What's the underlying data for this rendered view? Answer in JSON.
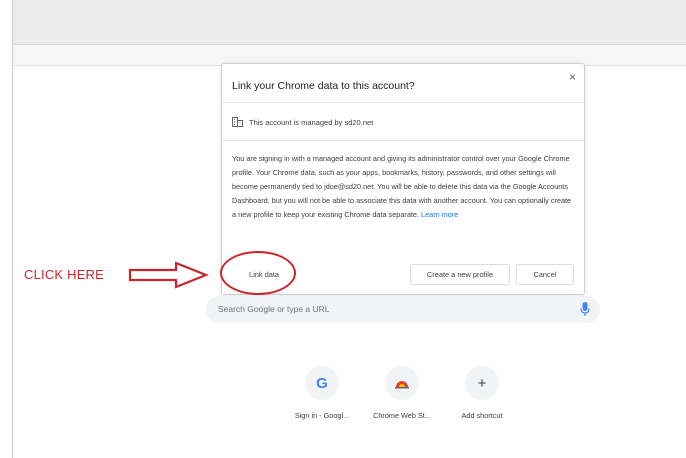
{
  "dialog": {
    "title": "Link your Chrome data to this account?",
    "managed_text": "This account is managed by sd20.net",
    "body_text": "You are signing in with a managed account and giving its administrator control over your Google Chrome profile. Your Chrome data, such as your apps, bookmarks, history, passwords, and other settings will become permanently tied to jdoe@sd20.net. You will be able to delete this data via the Google Accounts Dashboard, but you will not be able to associate this data with another account. You can optionally create a new profile to keep your existing Chrome data separate.",
    "learn_more": "Learn more",
    "buttons": {
      "link": "Link data",
      "create_profile": "Create a new profile",
      "cancel": "Cancel"
    },
    "close_glyph": "×"
  },
  "annotation": {
    "label": "CLICK HERE",
    "color": "#c8262c"
  },
  "search": {
    "placeholder": "Search Google or type a URL"
  },
  "shortcuts": [
    {
      "label": "Sign in - Googl...",
      "icon": "google-g-icon",
      "glyph": "G"
    },
    {
      "label": "Chrome Web St...",
      "icon": "chrome-web-store-icon"
    },
    {
      "label": "Add shortcut",
      "icon": "plus-icon",
      "glyph": "+"
    }
  ],
  "colors": {
    "link_blue": "#1a73e8",
    "mic_blue": "#4285f4",
    "annotation_red": "#c8262c"
  }
}
